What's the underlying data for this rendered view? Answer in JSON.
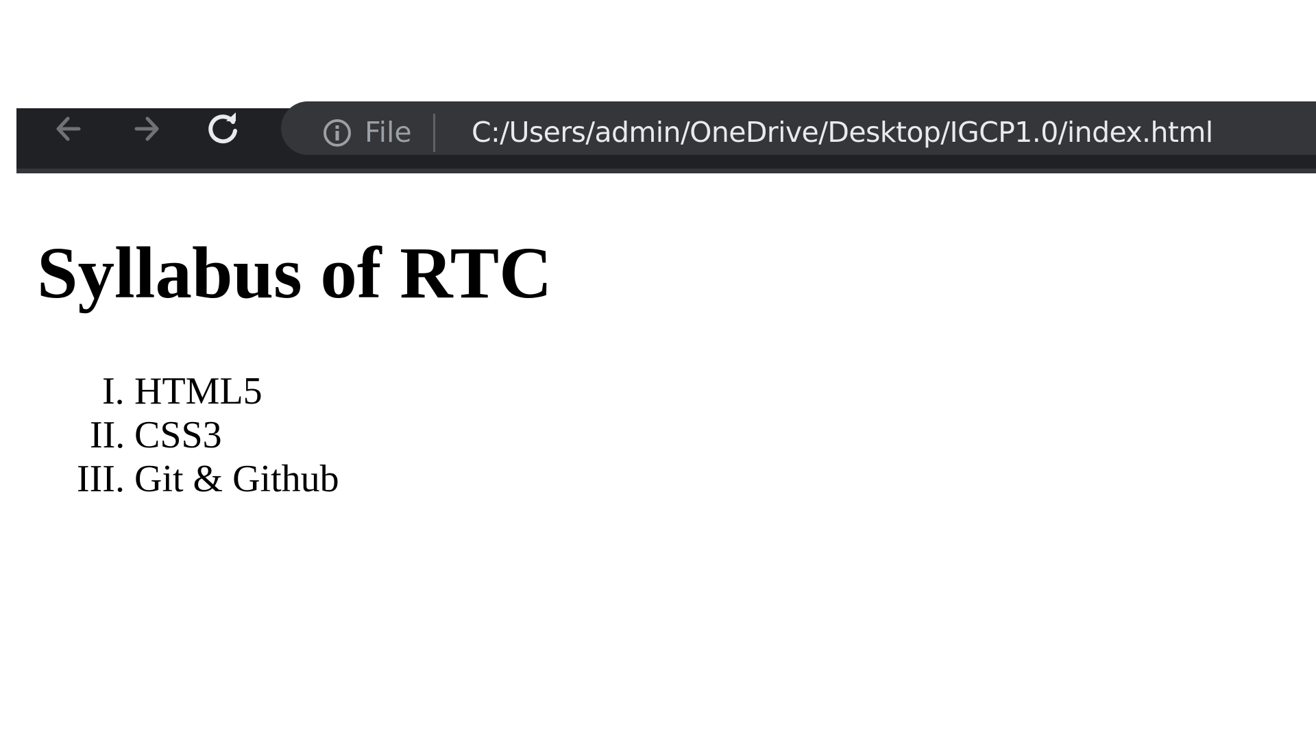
{
  "browser": {
    "back_icon": "arrow-left-icon",
    "forward_icon": "arrow-right-icon",
    "reload_icon": "reload-icon",
    "info_icon": "info-circle-icon",
    "scheme_label": "File",
    "url": "C:/Users/admin/OneDrive/Desktop/IGCP1.0/index.html",
    "colors": {
      "toolbar": "#202124",
      "omnibox": "#35363a",
      "url_text": "#e8eaed",
      "muted": "#9aa0a6"
    }
  },
  "page": {
    "title": "Syllabus of RTC",
    "list": {
      "style": "upper-roman",
      "items": [
        {
          "marker": "I.",
          "text": "HTML5"
        },
        {
          "marker": "II.",
          "text": "CSS3"
        },
        {
          "marker": "III.",
          "text": "Git & Github"
        }
      ]
    }
  }
}
